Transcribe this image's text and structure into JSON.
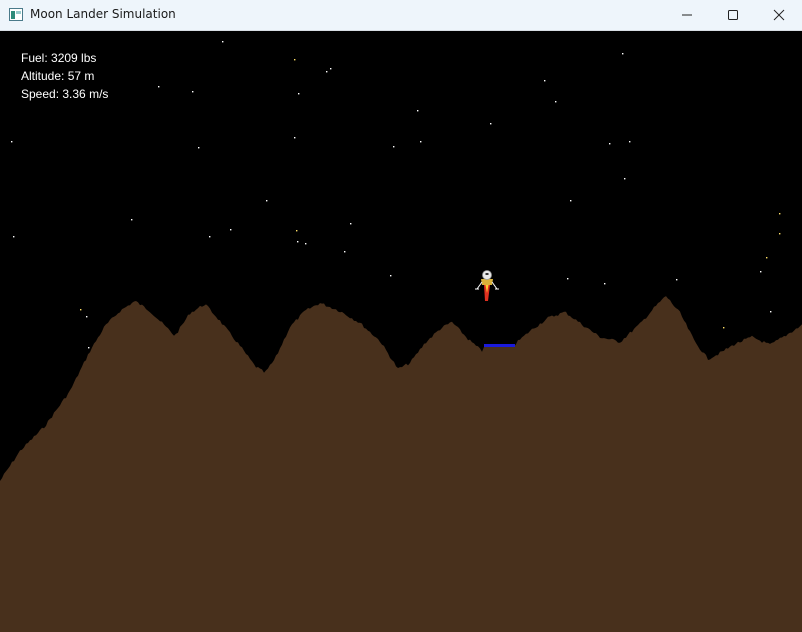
{
  "window": {
    "title": "Moon Lander Simulation",
    "icon": "app-window-icon",
    "controls": [
      "minimize-icon",
      "maximize-icon",
      "close-icon"
    ]
  },
  "hud": {
    "fuel_label": "Fuel: ",
    "fuel_value": "3209",
    "fuel_unit": " lbs",
    "altitude_label": "Altitude: ",
    "altitude_value": "57",
    "altitude_unit": " m",
    "speed_label": "Speed: ",
    "speed_value": "3.36",
    "speed_unit": " m/s"
  },
  "colors": {
    "sky": "#000000",
    "terrain": "#48301c",
    "landing_pad": "#1a1adb",
    "star_white": "#ffffff",
    "star_yellow": "#ffe066",
    "thrust_flame": "#e03020"
  }
}
